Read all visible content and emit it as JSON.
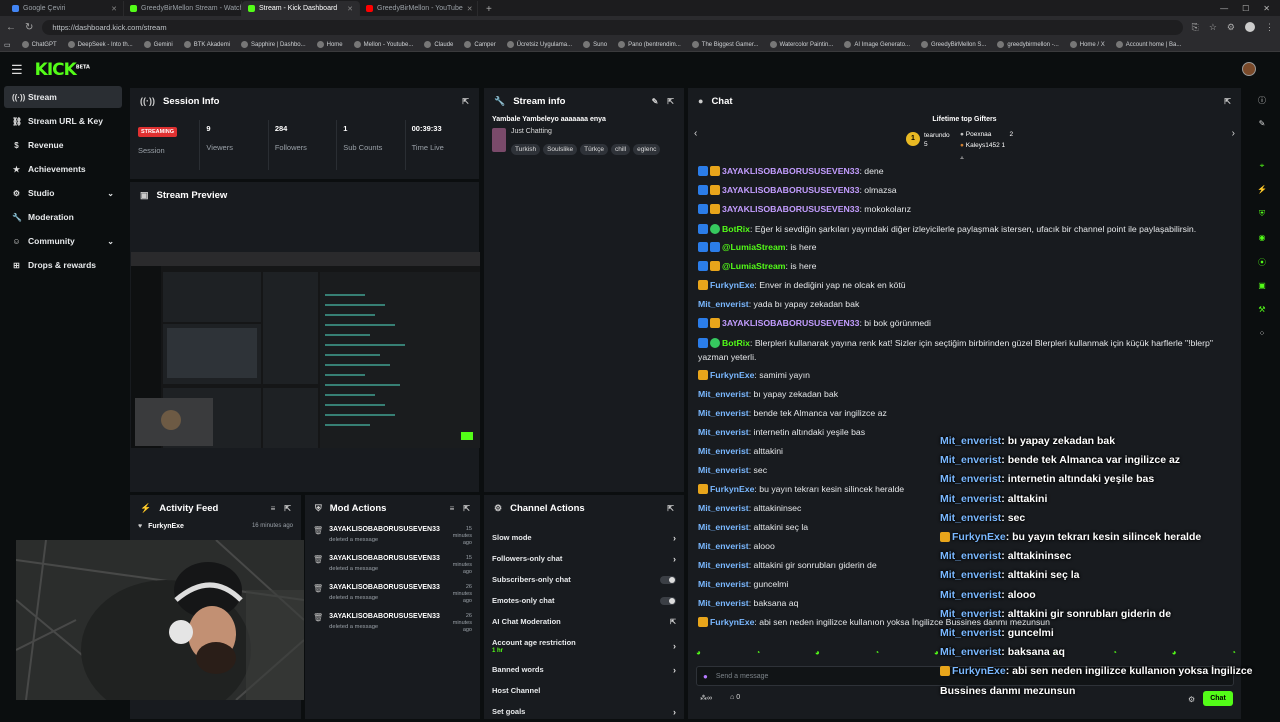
{
  "browser": {
    "tabs": [
      {
        "label": "Google Çeviri",
        "color": "#4285f4",
        "active": false
      },
      {
        "label": "GreedyBirMellon Stream - Watch",
        "color": "#53fc18",
        "active": false
      },
      {
        "label": "Stream - Kick Dashboard",
        "color": "#53fc18",
        "active": true
      },
      {
        "label": "GreedyBirMellon - YouTube",
        "color": "#ff0000",
        "active": false
      }
    ],
    "url": "https://dashboard.kick.com/stream",
    "bookmarks": [
      "ChatGPT",
      "DeepSeek - Into th...",
      "Gemini",
      "BTK Akademi",
      "Sapphire | Dashbo...",
      "Home",
      "Mellon - Youtube...",
      "Claude",
      "Camper",
      "Ücretsiz Uygulama...",
      "Suno",
      "Pano (bentrendim...",
      "The Biggest Gamer...",
      "Watercolor Paintin...",
      "AI Image Generato...",
      "GreedyBirMellon S...",
      "greedybirmellon -...",
      "Home / X",
      "Account home | Ba..."
    ]
  },
  "brand": {
    "logo": "KICK",
    "logo_sup": "BETA",
    "accent": "#53fc18"
  },
  "sidebar": {
    "items": [
      {
        "label": "Stream",
        "icon": "broadcast-icon",
        "active": true
      },
      {
        "label": "Stream URL & Key",
        "icon": "link-icon"
      },
      {
        "label": "Revenue",
        "icon": "dollar-icon"
      },
      {
        "label": "Achievements",
        "icon": "star-icon"
      },
      {
        "label": "Studio",
        "icon": "studio-icon",
        "chevron": true
      },
      {
        "label": "Moderation",
        "icon": "wrench-icon"
      },
      {
        "label": "Community",
        "icon": "community-icon",
        "chevron": true
      },
      {
        "label": "Drops & rewards",
        "icon": "gift-icon"
      }
    ]
  },
  "session": {
    "title": "Session Info",
    "status": "STREAMING",
    "stats": [
      {
        "label": "Session",
        "value": ""
      },
      {
        "label": "Viewers",
        "value": "9"
      },
      {
        "label": "Followers",
        "value": "284"
      },
      {
        "label": "Sub Counts",
        "value": "1"
      },
      {
        "label": "Time Live",
        "value": "00:39:33"
      }
    ]
  },
  "preview": {
    "title": "Stream Preview"
  },
  "stream_info": {
    "title": "Stream info",
    "stream_title": "Yambale Yambeleyo aaaaaaa enya",
    "category": "Just Chatting",
    "tags": [
      "Turkish",
      "Soulslike",
      "Türkçe",
      "chill",
      "eglenc"
    ]
  },
  "channel_actions": {
    "title": "Channel Actions",
    "items": [
      {
        "label": "Slow mode",
        "kind": "arrow"
      },
      {
        "label": "Followers-only chat",
        "kind": "arrow"
      },
      {
        "label": "Subscribers-only chat",
        "kind": "toggle"
      },
      {
        "label": "Emotes-only chat",
        "kind": "toggle"
      },
      {
        "label": "AI Chat Moderation",
        "kind": "external"
      },
      {
        "label": "Account age restriction",
        "sub": "1 hr",
        "kind": "arrow"
      },
      {
        "label": "Banned words",
        "kind": "arrow"
      },
      {
        "label": "Host Channel",
        "kind": "none"
      },
      {
        "label": "Set goals",
        "kind": "arrow"
      }
    ]
  },
  "activity": {
    "title": "Activity Feed",
    "items": [
      {
        "user": "FurkynExe",
        "time": "16 minutes ago"
      }
    ]
  },
  "mod_actions": {
    "title": "Mod Actions",
    "items": [
      {
        "user": "3AYAKLISOBABORUSUSEVEN33",
        "action": "deleted a message",
        "time": "15 minutes ago"
      },
      {
        "user": "3AYAKLISOBABORUSUSEVEN33",
        "action": "deleted a message",
        "time": "15 minutes ago"
      },
      {
        "user": "3AYAKLISOBABORUSUSEVEN33",
        "action": "deleted a message",
        "time": "26 minutes ago"
      },
      {
        "user": "3AYAKLISOBABORUSUSEVEN33",
        "action": "deleted a message",
        "time": "26 minutes ago"
      }
    ]
  },
  "chat": {
    "title": "Chat",
    "gifters_title": "Lifetime top Gifters",
    "gifters": [
      {
        "name": "tearundo",
        "count": "5"
      },
      {
        "name": "Poexnaa",
        "count": "2"
      },
      {
        "name": "Kaleys1452",
        "count": "1"
      }
    ],
    "messages": [
      {
        "user": "3AYAKLISOBABORUSUSEVEN33",
        "text": "dene",
        "badges": [
          "blue",
          "crown"
        ],
        "color": "purple"
      },
      {
        "user": "3AYAKLISOBABORUSUSEVEN33",
        "text": "olmazsa",
        "badges": [
          "blue",
          "crown"
        ],
        "color": "purple"
      },
      {
        "user": "3AYAKLISOBABORUSUSEVEN33",
        "text": "mokokolarız",
        "badges": [
          "blue",
          "crown"
        ],
        "color": "purple"
      },
      {
        "user": "BotRix",
        "text": "Eğer ki sevdiğin şarkıları yayındaki diğer izleyicilerle paylaşmak istersen, ufacık bir channel point ile paylaşabilirsin.",
        "badges": [
          "blue",
          "green"
        ],
        "color": "green",
        "wrap": true
      },
      {
        "user": "@LumiaStream",
        "text": "is here",
        "badges": [
          "blue",
          "blue"
        ],
        "color": "green"
      },
      {
        "user": "@LumiaStream",
        "text": "is here",
        "badges": [
          "blue",
          "crown"
        ],
        "color": "green"
      },
      {
        "user": "FurkynExe",
        "text": "Enver in dediğini yap ne olcak en kötü",
        "badges": [
          "crown"
        ],
        "color": "blue"
      },
      {
        "user": "Mit_enverist",
        "text": "yada bı yapay zekadan bak",
        "badges": [],
        "color": "blue"
      },
      {
        "user": "3AYAKLISOBABORUSUSEVEN33",
        "text": "bi bok görünmedi",
        "badges": [
          "blue",
          "crown"
        ],
        "color": "purple"
      },
      {
        "user": "BotRix",
        "text": "Blerpleri kullanarak yayına renk kat! Sizler için seçtiğim birbirinden güzel Blerpleri kullanmak için küçük harflerle \"!blerp\" yazman yeterli.",
        "badges": [
          "blue",
          "green"
        ],
        "color": "green",
        "wrap": true
      },
      {
        "user": "FurkynExe",
        "text": "samimi yayın",
        "badges": [
          "crown"
        ],
        "color": "blue"
      },
      {
        "user": "Mit_enverist",
        "text": "bı yapay zekadan bak",
        "badges": [],
        "color": "blue"
      },
      {
        "user": "Mit_enverist",
        "text": "bende tek Almanca var ingilizce az",
        "badges": [],
        "color": "blue"
      },
      {
        "user": "Mit_enverist",
        "text": "internetin altındaki yeşile bas",
        "badges": [],
        "color": "blue"
      },
      {
        "user": "Mit_enverist",
        "text": "alttakini",
        "badges": [],
        "color": "blue"
      },
      {
        "user": "Mit_enverist",
        "text": "sec",
        "badges": [],
        "color": "blue"
      },
      {
        "user": "FurkynExe",
        "text": "bu yayın tekrarı kesin silincek heralde",
        "badges": [
          "crown"
        ],
        "color": "blue"
      },
      {
        "user": "Mit_enverist",
        "text": "alttakininsec",
        "badges": [],
        "color": "blue"
      },
      {
        "user": "Mit_enverist",
        "text": "alttakini seç la",
        "badges": [],
        "color": "blue"
      },
      {
        "user": "Mit_enverist",
        "text": "alooo",
        "badges": [],
        "color": "blue"
      },
      {
        "user": "Mit_enverist",
        "text": "alttakini gir sonrubları giderin de",
        "badges": [],
        "color": "blue"
      },
      {
        "user": "Mit_enverist",
        "text": "guncelmi",
        "badges": [],
        "color": "blue"
      },
      {
        "user": "Mit_enverist",
        "text": "baksana aq",
        "badges": [],
        "color": "blue"
      },
      {
        "user": "FurkynExe",
        "text": "abi sen neden ingilizce kullanıon yoksa İngilizce Bussines danmı mezunsun",
        "badges": [
          "crown"
        ],
        "color": "blue"
      }
    ],
    "input_placeholder": "Send a message",
    "bottom_count": "0",
    "send_label": "Chat"
  },
  "overlay_chat": [
    {
      "user": "Mit_enverist",
      "text": ": bı yapay zekadan bak"
    },
    {
      "user": "Mit_enverist",
      "text": ": bende tek Almanca var ingilizce az"
    },
    {
      "user": "Mit_enverist",
      "text": ": internetin altındaki yeşile bas"
    },
    {
      "user": "Mit_enverist",
      "text": ": alttakini"
    },
    {
      "user": "Mit_enverist",
      "text": ": sec"
    },
    {
      "user": "FurkynExe",
      "text": ": bu yayın tekrarı kesin silincek heralde",
      "crown": true
    },
    {
      "user": "Mit_enverist",
      "text": ": alttakininsec"
    },
    {
      "user": "Mit_enverist",
      "text": ": alttakini seç la"
    },
    {
      "user": "Mit_enverist",
      "text": ": alooo"
    },
    {
      "user": "Mit_enverist",
      "text": ": alttakini gir sonrubları giderin de"
    },
    {
      "user": "Mit_enverist",
      "text": ": guncelmi"
    },
    {
      "user": "Mit_enverist",
      "text": ": baksana aq"
    },
    {
      "user": "FurkynExe",
      "text": ": abi sen neden ingilizce kullanıon yoksa İngilizce",
      "crown": true
    },
    {
      "user": "",
      "text": "Bussines danmı mezunsun"
    }
  ]
}
